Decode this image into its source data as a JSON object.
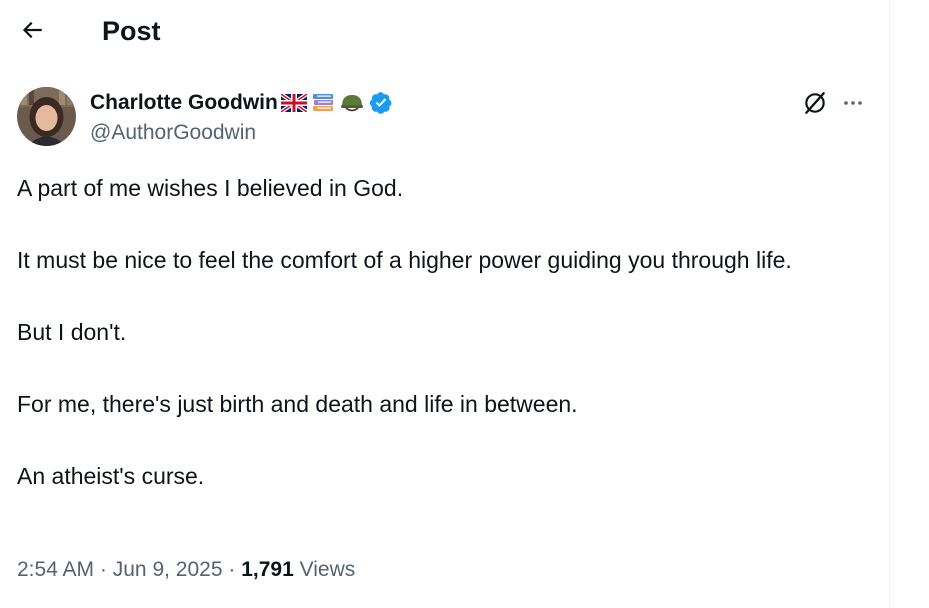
{
  "header": {
    "back_icon": "arrow-left-icon",
    "title": "Post"
  },
  "author": {
    "name": "Charlotte Goodwin",
    "handle": "@AuthorGoodwin",
    "badges": [
      "uk-flag-icon",
      "books-icon",
      "military-helmet-icon",
      "verified-badge-icon"
    ],
    "verified_color": "#1d9bf0"
  },
  "actions": {
    "grok_icon": "grok-icon",
    "more_icon": "more-dots-icon"
  },
  "post": {
    "paragraphs": [
      "A part of me wishes I believed in God.",
      "It must be nice to feel the comfort of a higher power guiding you through life.",
      "But I don't.",
      "For me, there's just birth and death and life in between.",
      "An atheist's curse."
    ]
  },
  "meta": {
    "time": "2:54 AM",
    "separator": "·",
    "date": "Jun 9, 2025",
    "views_count": "1,791",
    "views_label": "Views"
  },
  "colors": {
    "text_primary": "#0f1419",
    "text_secondary": "#536471",
    "accent": "#1d9bf0"
  }
}
